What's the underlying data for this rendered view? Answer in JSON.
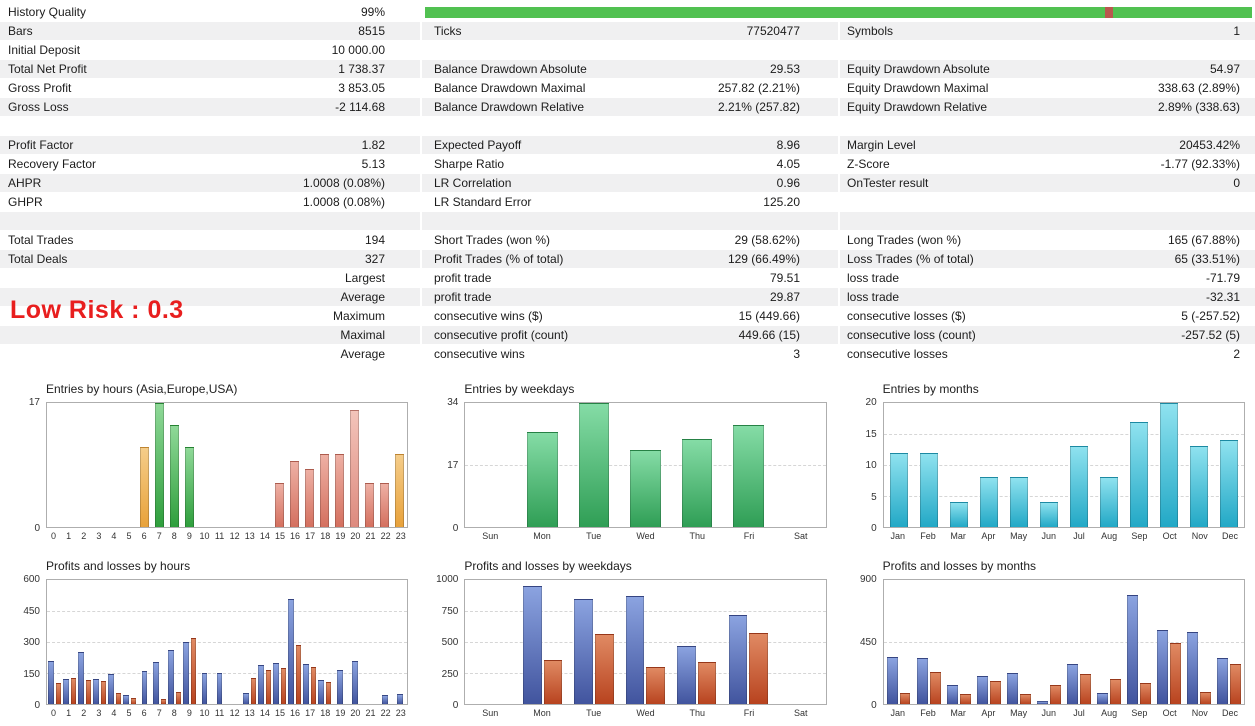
{
  "report": {
    "overlay_label": "Low Risk : 0.3",
    "overlay_color": "#e81e1e",
    "history_quality": {
      "label": "History Quality",
      "value": "99%",
      "bar_color": "#51c151",
      "gap_color": "#b9574e",
      "gap_position_pct": 82.2
    },
    "rows": [
      {
        "shade": true,
        "cells": [
          [
            "Bars",
            "8515"
          ],
          [
            "Ticks",
            "77520477"
          ],
          [
            "Symbols",
            "1"
          ]
        ]
      },
      {
        "shade": false,
        "cells": [
          [
            "Initial Deposit",
            "10 000.00"
          ],
          [
            "",
            ""
          ],
          [
            "",
            ""
          ]
        ]
      },
      {
        "shade": true,
        "cells": [
          [
            "Total Net Profit",
            "1 738.37"
          ],
          [
            "Balance Drawdown Absolute",
            "29.53"
          ],
          [
            "Equity Drawdown Absolute",
            "54.97"
          ]
        ]
      },
      {
        "shade": false,
        "cells": [
          [
            "Gross Profit",
            "3 853.05"
          ],
          [
            "Balance Drawdown Maximal",
            "257.82 (2.21%)"
          ],
          [
            "Equity Drawdown Maximal",
            "338.63 (2.89%)"
          ]
        ]
      },
      {
        "shade": true,
        "cells": [
          [
            "Gross Loss",
            "-2 114.68"
          ],
          [
            "Balance Drawdown Relative",
            "2.21% (257.82)"
          ],
          [
            "Equity Drawdown Relative",
            "2.89% (338.63)"
          ]
        ]
      },
      {
        "shade": false,
        "cells": [
          [
            "",
            ""
          ],
          [
            "",
            ""
          ],
          [
            "",
            ""
          ]
        ]
      },
      {
        "shade": true,
        "cells": [
          [
            "Profit Factor",
            "1.82"
          ],
          [
            "Expected Payoff",
            "8.96"
          ],
          [
            "Margin Level",
            "20453.42%"
          ]
        ]
      },
      {
        "shade": false,
        "cells": [
          [
            "Recovery Factor",
            "5.13"
          ],
          [
            "Sharpe Ratio",
            "4.05"
          ],
          [
            "Z-Score",
            "-1.77 (92.33%)"
          ]
        ]
      },
      {
        "shade": true,
        "cells": [
          [
            "AHPR",
            "1.0008 (0.08%)"
          ],
          [
            "LR Correlation",
            "0.96"
          ],
          [
            "OnTester result",
            "0"
          ]
        ]
      },
      {
        "shade": false,
        "cells": [
          [
            "GHPR",
            "1.0008 (0.08%)"
          ],
          [
            "LR Standard Error",
            "125.20"
          ],
          [
            "",
            ""
          ]
        ]
      },
      {
        "shade": true,
        "cells": [
          [
            "",
            ""
          ],
          [
            "",
            ""
          ],
          [
            "",
            ""
          ]
        ]
      },
      {
        "shade": false,
        "cells": [
          [
            "Total Trades",
            "194"
          ],
          [
            "Short Trades (won %)",
            "29 (58.62%)"
          ],
          [
            "Long Trades (won %)",
            "165 (67.88%)"
          ]
        ]
      },
      {
        "shade": true,
        "cells": [
          [
            "Total Deals",
            "327"
          ],
          [
            "Profit Trades (% of total)",
            "129 (66.49%)"
          ],
          [
            "Loss Trades (% of total)",
            "65 (33.51%)"
          ]
        ]
      },
      {
        "shade": false,
        "cells": [
          [
            "",
            "Largest"
          ],
          [
            "profit trade",
            "79.51"
          ],
          [
            "loss trade",
            "-71.79"
          ]
        ]
      },
      {
        "shade": true,
        "cells": [
          [
            "",
            "Average"
          ],
          [
            "profit trade",
            "29.87"
          ],
          [
            "loss trade",
            "-32.31"
          ]
        ]
      },
      {
        "shade": false,
        "cells": [
          [
            "",
            "Maximum"
          ],
          [
            "consecutive wins ($)",
            "15 (449.66)"
          ],
          [
            "consecutive losses ($)",
            "5 (-257.52)"
          ]
        ]
      },
      {
        "shade": true,
        "cells": [
          [
            "",
            "Maximal"
          ],
          [
            "consecutive profit (count)",
            "449.66 (15)"
          ],
          [
            "consecutive loss (count)",
            "-257.52 (5)"
          ]
        ]
      },
      {
        "shade": false,
        "cells": [
          [
            "",
            "Average"
          ],
          [
            "consecutive wins",
            "3"
          ],
          [
            "consecutive losses",
            "2"
          ]
        ]
      }
    ]
  },
  "colors": {
    "green": [
      "#2e9e3c",
      "#8fd998"
    ],
    "orange": [
      "#e8a23b",
      "#f5cd8a"
    ],
    "salmon": [
      "#d4705f",
      "#eeb0a4"
    ],
    "salmon_light": [
      "#dd8a7e",
      "#f3c4ba"
    ],
    "weekday_green": [
      "#2f9e55",
      "#85dca6"
    ],
    "month_cyan": [
      "#22a8c6",
      "#8fe2ef"
    ],
    "profit_blue": [
      "#41549e",
      "#8ba3e0"
    ],
    "loss_red": [
      "#b8431f",
      "#e08a63"
    ]
  },
  "chart_data": [
    {
      "type": "bar",
      "title": "Entries by hours (Asia,Europe,USA)",
      "categories": [
        "0",
        "1",
        "2",
        "3",
        "4",
        "5",
        "6",
        "7",
        "8",
        "9",
        "10",
        "11",
        "12",
        "13",
        "14",
        "15",
        "16",
        "17",
        "18",
        "19",
        "20",
        "21",
        "22",
        "23"
      ],
      "values": [
        0,
        0,
        0,
        0,
        0,
        0,
        11,
        17,
        14,
        11,
        0,
        0,
        0,
        0,
        0,
        6,
        9,
        8,
        10,
        10,
        16,
        6,
        6,
        10
      ],
      "colors_by_bar": [
        "",
        "",
        "",
        "",
        "",
        "",
        "orange",
        "green",
        "green",
        "green",
        "",
        "",
        "",
        "",
        "",
        "salmon",
        "salmon",
        "salmon",
        "salmon",
        "salmon",
        "salmon_light",
        "salmon",
        "salmon",
        "orange"
      ],
      "ylim": [
        0,
        17
      ],
      "yticks": [
        0,
        17
      ]
    },
    {
      "type": "bar",
      "title": "Entries by weekdays",
      "categories": [
        "Sun",
        "Mon",
        "Tue",
        "Wed",
        "Thu",
        "Fri",
        "Sat"
      ],
      "values": [
        0,
        26,
        34,
        21,
        24,
        28,
        0
      ],
      "color": "weekday_green",
      "ylim": [
        0,
        34
      ],
      "yticks": [
        0,
        17,
        34
      ]
    },
    {
      "type": "bar",
      "title": "Entries by months",
      "categories": [
        "Jan",
        "Feb",
        "Mar",
        "Apr",
        "May",
        "Jun",
        "Jul",
        "Aug",
        "Sep",
        "Oct",
        "Nov",
        "Dec"
      ],
      "values": [
        12,
        12,
        4,
        8,
        8,
        4,
        13,
        8,
        17,
        20,
        13,
        14
      ],
      "color": "month_cyan",
      "ylim": [
        0,
        20
      ],
      "yticks": [
        0,
        5,
        10,
        15,
        20
      ]
    },
    {
      "type": "bar",
      "title": "Profits and losses by hours",
      "categories": [
        "0",
        "1",
        "2",
        "3",
        "4",
        "5",
        "6",
        "7",
        "8",
        "9",
        "10",
        "11",
        "12",
        "13",
        "14",
        "15",
        "16",
        "17",
        "18",
        "19",
        "20",
        "21",
        "22",
        "23"
      ],
      "series": [
        {
          "name": "profits",
          "color": "profit_blue",
          "values": [
            210,
            120,
            250,
            120,
            145,
            45,
            160,
            205,
            260,
            300,
            150,
            150,
            0,
            55,
            190,
            200,
            510,
            195,
            115,
            165,
            210,
            0,
            45,
            50
          ]
        },
        {
          "name": "losses",
          "color": "loss_red",
          "values": [
            100,
            125,
            115,
            110,
            55,
            30,
            0,
            25,
            60,
            320,
            0,
            0,
            0,
            125,
            165,
            175,
            285,
            180,
            105,
            0,
            0,
            0,
            0,
            0
          ]
        }
      ],
      "ylim": [
        0,
        600
      ],
      "yticks": [
        0,
        150,
        300,
        450,
        600
      ]
    },
    {
      "type": "bar",
      "title": "Profits and losses by weekdays",
      "categories": [
        "Sun",
        "Mon",
        "Tue",
        "Wed",
        "Thu",
        "Fri",
        "Sat"
      ],
      "series": [
        {
          "name": "profits",
          "color": "profit_blue",
          "values": [
            0,
            950,
            850,
            870,
            470,
            720,
            0
          ]
        },
        {
          "name": "losses",
          "color": "loss_red",
          "values": [
            0,
            355,
            565,
            300,
            340,
            575,
            0
          ]
        }
      ],
      "ylim": [
        0,
        1000
      ],
      "yticks": [
        0,
        250,
        500,
        750,
        1000
      ]
    },
    {
      "type": "bar",
      "title": "Profits and losses by months",
      "categories": [
        "Jan",
        "Feb",
        "Mar",
        "Apr",
        "May",
        "Jun",
        "Jul",
        "Aug",
        "Sep",
        "Oct",
        "Nov",
        "Dec"
      ],
      "series": [
        {
          "name": "profits",
          "color": "profit_blue",
          "values": [
            340,
            335,
            135,
            200,
            225,
            20,
            290,
            80,
            790,
            540,
            525,
            335
          ]
        },
        {
          "name": "losses",
          "color": "loss_red",
          "values": [
            80,
            235,
            70,
            165,
            70,
            135,
            215,
            185,
            150,
            440,
            85,
            290
          ]
        }
      ],
      "ylim": [
        0,
        900
      ],
      "yticks": [
        0,
        450,
        900
      ]
    }
  ]
}
